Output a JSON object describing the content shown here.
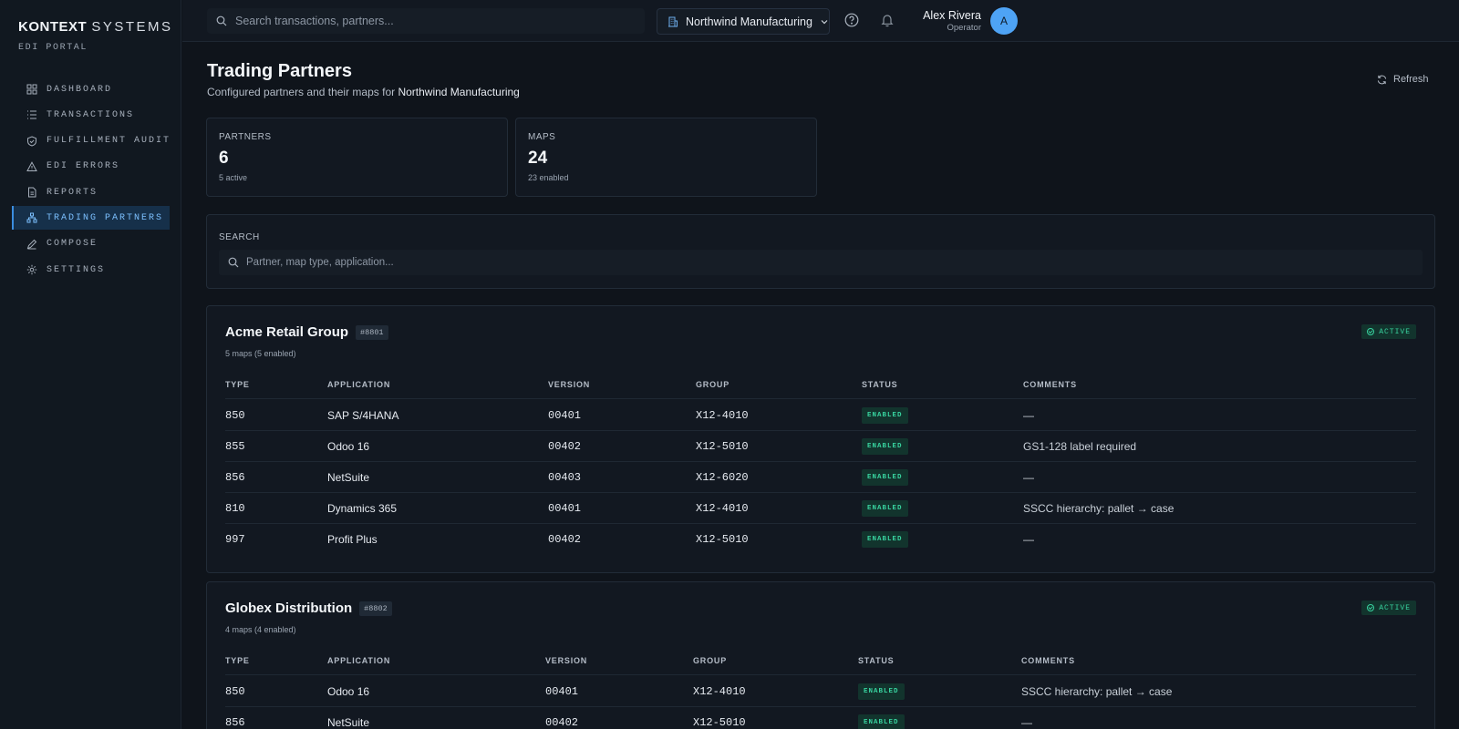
{
  "brand": {
    "name_bold": "KONTEXT",
    "name_rest": "SYSTEMS",
    "subtitle": "EDI PORTAL"
  },
  "sidebar": {
    "items": [
      {
        "label": "DASHBOARD",
        "icon": "grid-icon",
        "active": false
      },
      {
        "label": "TRANSACTIONS",
        "icon": "list-icon",
        "active": false
      },
      {
        "label": "FULFILLMENT AUDIT",
        "icon": "shield-icon",
        "active": false
      },
      {
        "label": "EDI ERRORS",
        "icon": "warning-icon",
        "active": false
      },
      {
        "label": "REPORTS",
        "icon": "document-icon",
        "active": false
      },
      {
        "label": "TRADING PARTNERS",
        "icon": "network-icon",
        "active": true
      },
      {
        "label": "COMPOSE",
        "icon": "pen-icon",
        "active": false
      },
      {
        "label": "SETTINGS",
        "icon": "gear-icon",
        "active": false
      }
    ]
  },
  "topbar": {
    "search_placeholder": "Search transactions, partners...",
    "org": "Northwind Manufacturing",
    "user_name": "Alex Rivera",
    "user_role": "Operator",
    "avatar_initial": "A"
  },
  "page": {
    "title": "Trading Partners",
    "subtitle_prefix": "Configured partners and their maps for",
    "subtitle_org": "Northwind Manufacturing",
    "refresh_label": "Refresh"
  },
  "stats": {
    "partners": {
      "label": "PARTNERS",
      "value": "6",
      "sub": "5 active"
    },
    "maps": {
      "label": "MAPS",
      "value": "24",
      "sub": "23 enabled"
    }
  },
  "search": {
    "label": "SEARCH",
    "placeholder": "Partner, map type, application..."
  },
  "columns": [
    "TYPE",
    "APPLICATION",
    "VERSION",
    "GROUP",
    "STATUS",
    "COMMENTS"
  ],
  "partners": [
    {
      "name": "Acme Retail Group",
      "id": "#8801",
      "maps_summary": "5 maps (5 enabled)",
      "status": "ACTIVE",
      "rows": [
        {
          "type": "850",
          "application": "SAP S/4HANA",
          "version": "00401",
          "group": "X12-4010",
          "status": "ENABLED",
          "comments": "—"
        },
        {
          "type": "855",
          "application": "Odoo 16",
          "version": "00402",
          "group": "X12-5010",
          "status": "ENABLED",
          "comments": "GS1-128 label required"
        },
        {
          "type": "856",
          "application": "NetSuite",
          "version": "00403",
          "group": "X12-6020",
          "status": "ENABLED",
          "comments": "—"
        },
        {
          "type": "810",
          "application": "Dynamics 365",
          "version": "00401",
          "group": "X12-4010",
          "status": "ENABLED",
          "comments": "SSCC hierarchy: pallet → case"
        },
        {
          "type": "997",
          "application": "Profit Plus",
          "version": "00402",
          "group": "X12-5010",
          "status": "ENABLED",
          "comments": "—"
        }
      ]
    },
    {
      "name": "Globex Distribution",
      "id": "#8802",
      "maps_summary": "4 maps (4 enabled)",
      "status": "ACTIVE",
      "rows": [
        {
          "type": "850",
          "application": "Odoo 16",
          "version": "00401",
          "group": "X12-4010",
          "status": "ENABLED",
          "comments": "SSCC hierarchy: pallet → case"
        },
        {
          "type": "856",
          "application": "NetSuite",
          "version": "00402",
          "group": "X12-5010",
          "status": "ENABLED",
          "comments": "—"
        }
      ]
    }
  ]
}
